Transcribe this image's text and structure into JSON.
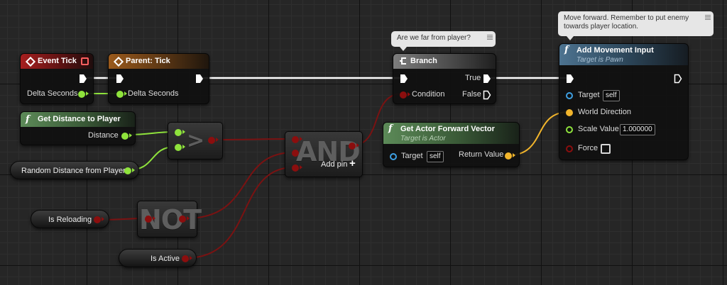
{
  "nodes": {
    "event_tick": {
      "title": "Event Tick",
      "delta_label": "Delta Seconds"
    },
    "parent_tick": {
      "title": "Parent: Tick",
      "delta_label": "Delta Seconds"
    },
    "get_distance": {
      "title": "Get Distance to Player",
      "output_label": "Distance"
    },
    "random_distance": {
      "label": "Random Distance from Player"
    },
    "greater": {
      "symbol": ">"
    },
    "and_node": {
      "symbol": "AND",
      "add_pin_label": "Add pin",
      "add_pin_icon": "+"
    },
    "not_node": {
      "symbol": "NOT"
    },
    "is_reloading": {
      "label": "Is Reloading"
    },
    "is_active": {
      "label": "Is Active"
    },
    "branch": {
      "title": "Branch",
      "comment": "Are we far from player?",
      "condition_label": "Condition",
      "true_label": "True",
      "false_label": "False"
    },
    "forward_vector": {
      "title": "Get Actor Forward Vector",
      "subtitle": "Target is Actor",
      "target_label": "Target",
      "target_value": "self",
      "return_label": "Return Value"
    },
    "add_movement": {
      "title": "Add Movement Input",
      "subtitle": "Target is Pawn",
      "comment": "Move forward. Remember to put enemy towards player location.",
      "target_label": "Target",
      "target_value": "self",
      "direction_label": "World Direction",
      "scale_label": "Scale Value",
      "scale_value": "1.000000",
      "force_label": "Force"
    }
  },
  "function_icon": "f",
  "colors": {
    "exec_wire": "#ffffff",
    "float_wire": "#8fe33c",
    "bool_wire": "#8b0e0e",
    "vector_wire": "#f2b52c",
    "object_pin": "#3ea0e3",
    "event_header": "#a71f1f",
    "parent_header": "#9a5a1c",
    "function_header": "#4d7390",
    "pure_header": "#5c8a58"
  }
}
